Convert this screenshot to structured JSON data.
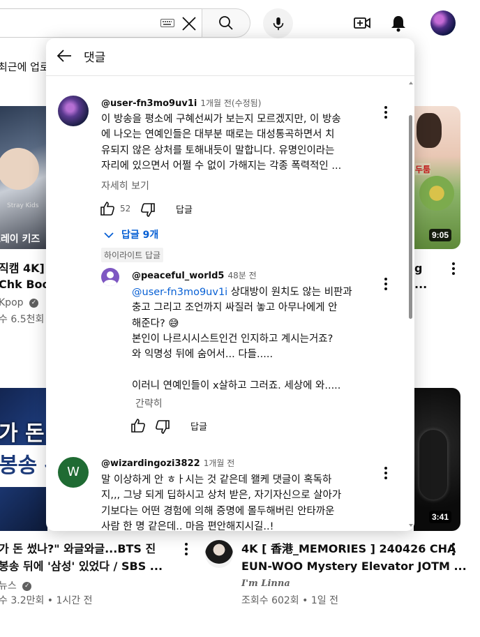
{
  "header": {
    "search_icon": "search-icon",
    "keyboard_icon": "keyboard-icon",
    "clear_icon": "close-icon",
    "mic_icon": "mic-icon",
    "create_icon": "create-video-icon",
    "notifications_icon": "bell-icon"
  },
  "feed": {
    "filter_partial": "최근에 업로",
    "left_top": {
      "title_line1": "직캠 4K]",
      "title_line2": "Chk Boo",
      "channel": "Kpop",
      "views": "수 6.5천회",
      "thumb_text": "트레이 키즈",
      "thumb_small": "Stray Kids"
    },
    "right_top": {
      "title_line1": "g",
      "title_line2": "...",
      "duration": "9:05",
      "thumb_tag": "두툼"
    },
    "left_bottom": {
      "title_line1": "가 돈 썼나?\" 와글와글...BTS 진",
      "title_line2": "봉송 뒤에 '삼성' 있었다 / SBS ...",
      "channel": "뉴스",
      "meta": "수 3.2만회 • 1시간 전",
      "thumb_line1": "가 돈 ",
      "thumb_line2": "봉송 뒤"
    },
    "right_bottom": {
      "title_line1": "4K [ 香港_MEMORIES ] 240426 CHA",
      "title_line2": "EUN-WOO Mystery Elevator JOTM ...",
      "channel": "I'm Linna",
      "meta": "조회수 602회 • 1일 전",
      "duration": "3:41"
    }
  },
  "panel": {
    "title": "댓글",
    "comments": [
      {
        "author": "@user-fn3mo9uv1i",
        "time": "1개월 전(수정됨)",
        "lines": [
          "이 방송을 평소에 구혜선씨가 보는지 모르겠지만, 이 방송",
          "에 나오는 연예인들은 대부분 때로는 대성통곡하면서 치",
          "유되지 않은 상처를 토해내듯이 말합니다. 유명인이라는",
          "자리에 있으면서 어쩔 수 없이 가해지는 각종 폭력적인 ..."
        ],
        "more": "자세히 보기",
        "likes": "52",
        "reply": "답글",
        "replies_toggle": "답글 9개"
      }
    ],
    "highlight_chip": "하이라이트 답글",
    "reply": {
      "author": "@peaceful_world5",
      "time": "48분 전",
      "mention": "@user-fn3mo9uv1i",
      "line1_rest": " 상대방이 원치도 않는 비판과",
      "lines": [
        "충고 그리고 조언까지 싸질러 놓고 아무나에게  안",
        "해준다? 😅",
        "본인이 나르시시스트인건 인지하고 계시는거죠?",
        "와 익명성 뒤에 숨어서... 다들.....",
        "",
        "이러니 연예인들이 x살하고 그러죠. 세상에 와....."
      ],
      "less": "간략히",
      "reply": "답글"
    },
    "comment2": {
      "author": "@wizardingozi3822",
      "time": "1개월 전",
      "avatar_letter": "W",
      "lines": [
        "말 이상하게 안 ㅎㅏ시는 것 같은데 왤케 댓글이 혹독하",
        "지,,, 그냥 되게 딥하시고 상처 받은, 자기자신으로 살아가",
        "기보다는 어떤 경험에 의해 증명에 몰두해버린 안타까운",
        "사람 한 명 같은데.. 마음 편안해지시길..!"
      ]
    }
  },
  "colors": {
    "link": "#065fd4",
    "avatar_w": "#1f6b33",
    "avatar_default": "#7e57c2"
  }
}
